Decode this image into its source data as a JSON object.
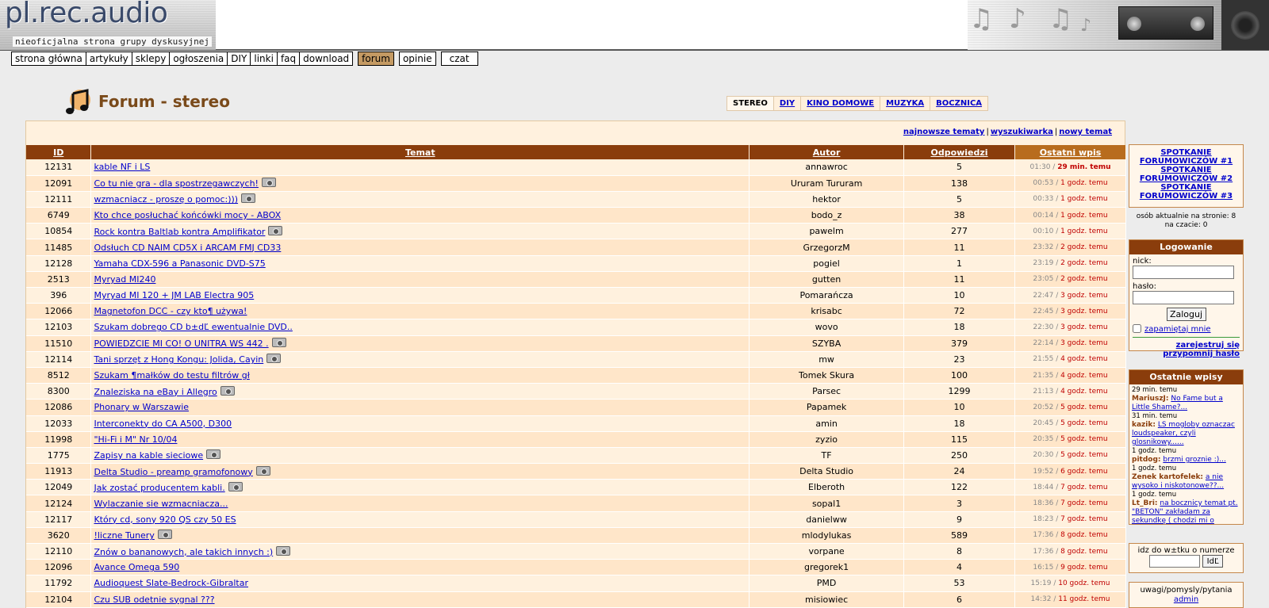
{
  "header": {
    "logo_title": "pl.rec.audio",
    "logo_subtitle": "nieoficjalna strona grupy dyskusyjnej"
  },
  "nav": {
    "items": [
      "strona główna",
      "artykuły",
      "sklepy",
      "ogłoszenia",
      "DIY",
      "linki",
      "faq",
      "download"
    ],
    "items_right": [
      "forum",
      "opinie",
      "czat"
    ],
    "active": "forum"
  },
  "page": {
    "title": "Forum - stereo",
    "subtabs": [
      "STEREO",
      "DIY",
      "KINO DOMOWE",
      "MUZYKA",
      "BOCZNICA"
    ],
    "active_subtab": "STEREO"
  },
  "top_links": {
    "newest": "najnowsze tematy",
    "search": "wyszukiwarka",
    "new_topic": "nowy temat"
  },
  "table": {
    "headers": {
      "id": "ID",
      "topic": "Temat",
      "author": "Autor",
      "replies": "Odpowiedzi",
      "last": "Ostatni wpis"
    },
    "rows": [
      {
        "id": "12131",
        "topic": "kable NF i LS",
        "author": "annawroc",
        "replies": "5",
        "time": "01:30",
        "ago": "29 min. temu"
      },
      {
        "id": "12091",
        "topic": "Co tu nie gra - dla spostrzegawczych!",
        "author": "Ururam Tururam",
        "replies": "138",
        "time": "00:53",
        "ago": "1 godz. temu"
      },
      {
        "id": "12111",
        "topic": "wzmacniacz - proszę o pomoc:)))",
        "author": "hektor",
        "replies": "5",
        "time": "00:33",
        "ago": "1 godz. temu"
      },
      {
        "id": "6749",
        "topic": "Kto chce posłuchać końcówki mocy - ABOX",
        "author": "bodo_z",
        "replies": "38",
        "time": "00:14",
        "ago": "1 godz. temu"
      },
      {
        "id": "10854",
        "topic": "Rock kontra Baltlab kontra Amplifikator",
        "author": "pawelm",
        "replies": "277",
        "time": "00:10",
        "ago": "1 godz. temu"
      },
      {
        "id": "11485",
        "topic": "Odsłuch CD NAIM CD5X i ARCAM FMJ CD33",
        "author": "GrzegorzM",
        "replies": "11",
        "time": "23:32",
        "ago": "2 godz. temu"
      },
      {
        "id": "12128",
        "topic": "Yamaha CDX-596 a Panasonic DVD-S75",
        "author": "pogiel",
        "replies": "1",
        "time": "23:19",
        "ago": "2 godz. temu"
      },
      {
        "id": "2513",
        "topic": "Myryad MI240",
        "author": "gutten",
        "replies": "11",
        "time": "23:05",
        "ago": "2 godz. temu"
      },
      {
        "id": "396",
        "topic": "Myryad MI 120 + JM LAB Electra 905",
        "author": "Pomarańcza",
        "replies": "10",
        "time": "22:47",
        "ago": "3 godz. temu"
      },
      {
        "id": "12066",
        "topic": "Magnetofon DCC - czy kto¶ używa!",
        "author": "krisabc",
        "replies": "72",
        "time": "22:45",
        "ago": "3 godz. temu"
      },
      {
        "id": "12103",
        "topic": "Szukam dobrego CD b±dĽ ewentualnie DVD..",
        "author": "wovo",
        "replies": "18",
        "time": "22:30",
        "ago": "3 godz. temu"
      },
      {
        "id": "11510",
        "topic": "POWIEDZCIE MI CO! O UNITRA WS 442 .",
        "author": "SZYBA",
        "replies": "379",
        "time": "22:14",
        "ago": "3 godz. temu"
      },
      {
        "id": "12114",
        "topic": "Tani sprzęt z Hong Kongu: Jolida, Cayin",
        "author": "mw",
        "replies": "23",
        "time": "21:55",
        "ago": "4 godz. temu"
      },
      {
        "id": "8512",
        "topic": "Szukam ¶małków do testu filtrów gł",
        "author": "Tomek Skura",
        "replies": "100",
        "time": "21:35",
        "ago": "4 godz. temu"
      },
      {
        "id": "8300",
        "topic": "Znaleziska na eBay i Allegro",
        "author": "Parsec",
        "replies": "1299",
        "time": "21:13",
        "ago": "4 godz. temu"
      },
      {
        "id": "12086",
        "topic": "Phonary w Warszawie",
        "author": "Papamek",
        "replies": "10",
        "time": "20:52",
        "ago": "5 godz. temu"
      },
      {
        "id": "12033",
        "topic": "Interconekty do CA A500, D300",
        "author": "amin",
        "replies": "18",
        "time": "20:45",
        "ago": "5 godz. temu"
      },
      {
        "id": "11998",
        "topic": "\"Hi-Fi i M\" Nr 10/04",
        "author": "zyzio",
        "replies": "115",
        "time": "20:35",
        "ago": "5 godz. temu"
      },
      {
        "id": "1775",
        "topic": "Zapisy na kable sieciowe",
        "author": "TF",
        "replies": "250",
        "time": "20:30",
        "ago": "5 godz. temu"
      },
      {
        "id": "11913",
        "topic": "Delta Studio - preamp gramofonowy",
        "author": "Delta Studio",
        "replies": "24",
        "time": "19:52",
        "ago": "6 godz. temu"
      },
      {
        "id": "12049",
        "topic": "Jak zostać producentem kabli.",
        "author": "Elberoth",
        "replies": "122",
        "time": "18:44",
        "ago": "7 godz. temu"
      },
      {
        "id": "12124",
        "topic": "Wylaczanie sie wzmacniacza...",
        "author": "sopal1",
        "replies": "3",
        "time": "18:36",
        "ago": "7 godz. temu"
      },
      {
        "id": "12117",
        "topic": "Który cd, sony 920 QS czy 50 ES",
        "author": "danielww",
        "replies": "9",
        "time": "18:23",
        "ago": "7 godz. temu"
      },
      {
        "id": "3620",
        "topic": "!liczne Tunery",
        "author": "mlodylukas",
        "replies": "589",
        "time": "17:36",
        "ago": "8 godz. temu"
      },
      {
        "id": "12110",
        "topic": "Znów o bananowych, ale takich innych :)",
        "author": "vorpane",
        "replies": "8",
        "time": "17:36",
        "ago": "8 godz. temu"
      },
      {
        "id": "12096",
        "topic": "Avance Omega 590",
        "author": "gregorek1",
        "replies": "4",
        "time": "16:15",
        "ago": "9 godz. temu"
      },
      {
        "id": "11792",
        "topic": "Audioquest Slate-Bedrock-Gibraltar",
        "author": "PMD",
        "replies": "53",
        "time": "15:19",
        "ago": "10 godz. temu"
      },
      {
        "id": "12104",
        "topic": "Czu SUB odetnie sygnal ???",
        "author": "misiowiec",
        "replies": "6",
        "time": "14:32",
        "ago": "11 godz. temu"
      }
    ]
  },
  "sidebar": {
    "meetings": [
      "SPOTKANIE FORUMOWICZÓW #1",
      "SPOTKANIE FORUMOWICZÓW #2",
      "SPOTKANIE FORUMOWICZÓW #3"
    ],
    "online_line1": "osób aktualnie na stronie: 8",
    "online_line2": "na czacie: 0",
    "login": {
      "title": "Logowanie",
      "nick_label": "nick:",
      "password_label": "hasło:",
      "submit": "Zaloguj",
      "remember": "zapamiętaj mnie",
      "register": "zarejestruj się",
      "remind": "przypomnij hasło"
    },
    "recent": {
      "title": "Ostatnie wpisy",
      "items": [
        {
          "ago": "29 min. temu",
          "user": "MariuszJ:",
          "text": "No Fame but a Little Shame?..."
        },
        {
          "ago": "31 min. temu",
          "user": "kazik:",
          "text": "LS mogloby oznaczac loudspeaker, czyli glosnikowy......"
        },
        {
          "ago": "1 godz. temu",
          "user": "pitdog:",
          "text": "brzmi groznie :)..."
        },
        {
          "ago": "1 godz. temu",
          "user": "Zenek kartofelek:",
          "text": "a nie wysoko i niskotonowe??..."
        },
        {
          "ago": "1 godz. temu",
          "user": "Lt_Bri:",
          "text": "na bocznicy temat pt. \"BETON\" zakładam za sekundkę ( chodzi mi o pewien materiał..."
        }
      ]
    },
    "goto": {
      "label": "idz do w±tku o numerze",
      "button": "IdĽ"
    },
    "feedback": {
      "label": "uwagi/pomysly/pytania",
      "link": "admin"
    }
  }
}
